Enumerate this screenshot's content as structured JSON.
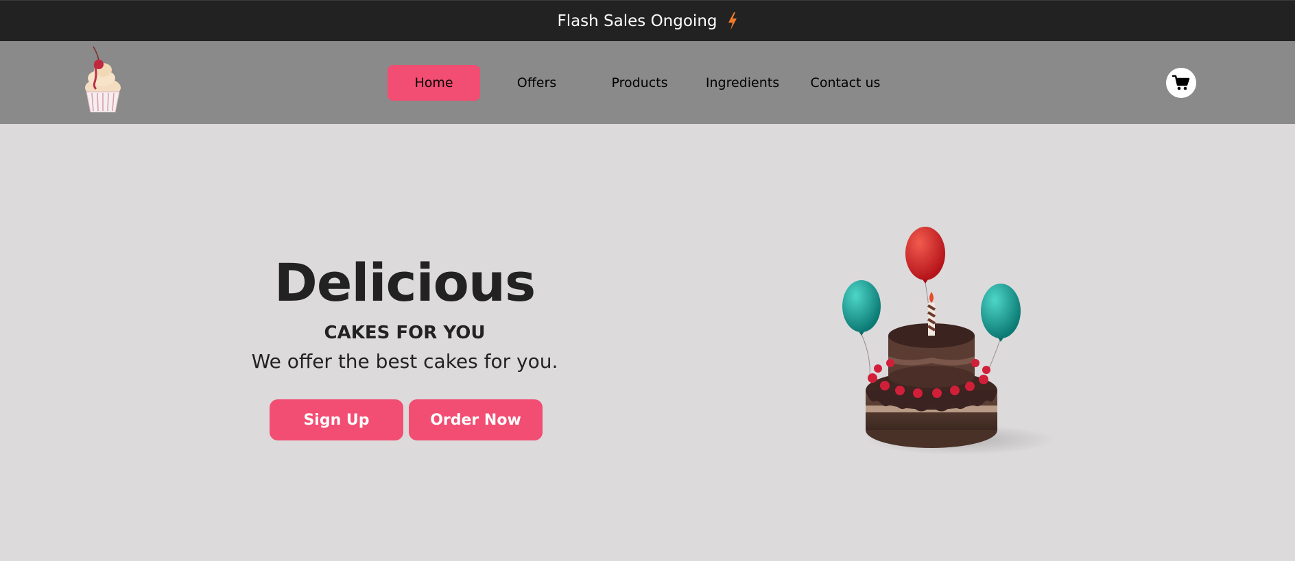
{
  "banner": {
    "text": "Flash Sales Ongoing",
    "icon": "lightning-bolt-icon",
    "icon_color": "#f47a2a",
    "background": "#222222"
  },
  "nav": {
    "logo": "cupcake-logo",
    "links": [
      {
        "label": "Home",
        "active": true
      },
      {
        "label": "Offers",
        "active": false
      },
      {
        "label": "Products",
        "active": false
      },
      {
        "label": "Ingredients",
        "active": false
      },
      {
        "label": "Contact us",
        "active": false
      }
    ],
    "cart_icon": "shopping-cart-icon",
    "accent": "#f24d72",
    "background": "#8a8a8a"
  },
  "hero": {
    "title": "Delicious",
    "subtitle": "CAKES FOR YOU",
    "description": "We offer the best cakes for you.",
    "buttons": {
      "signup": "Sign Up",
      "order": "Order Now"
    },
    "image": "birthday-cake-with-balloons",
    "background": "#dcdadb"
  }
}
